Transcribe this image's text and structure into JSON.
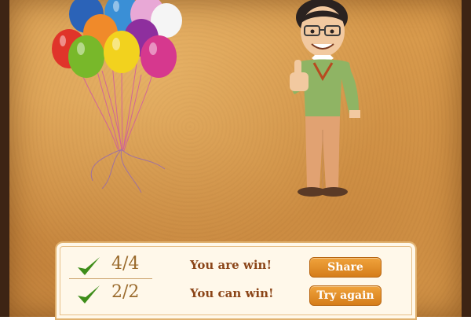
{
  "results": [
    {
      "score": "4/4",
      "message": "You are win!",
      "button": "Share"
    },
    {
      "score": "2/2",
      "message": "You can win!",
      "button": "Try again"
    }
  ],
  "icons": {
    "check": "check-icon",
    "balloons": "balloons-icon",
    "character": "thumbs-up-character"
  },
  "colors": {
    "button": "#e08a22",
    "check": "#3e8d1a",
    "message": "#8b4518",
    "score": "#9a6a2c",
    "background": "#d89a4c"
  }
}
